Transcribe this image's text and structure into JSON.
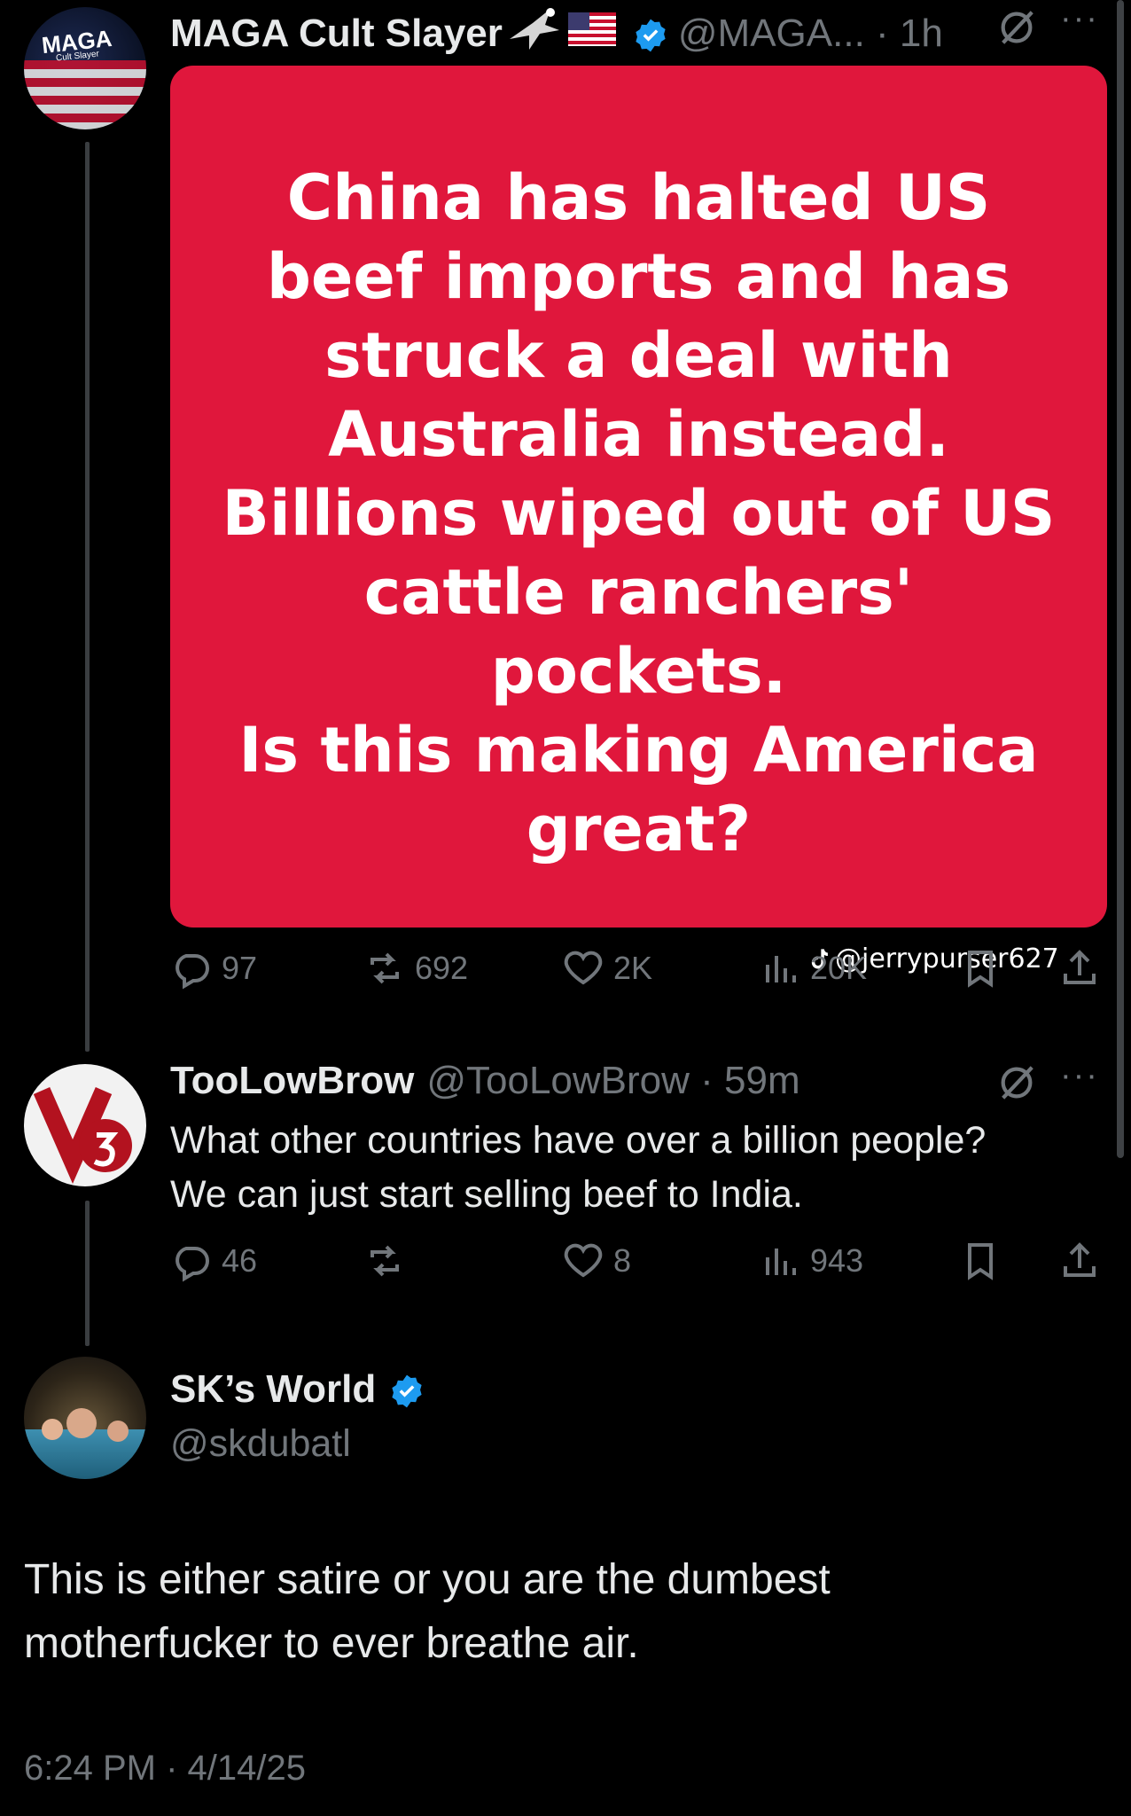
{
  "tweet1": {
    "display_name": "MAGA Cult Slayer",
    "handle_time": "@MAGA... · 1h",
    "avatar_text": "MAGA",
    "avatar_subtext": "Cult Slayer",
    "card_main": "China has halted US beef imports and has struck a deal with Australia instead. Billions wiped out of US cattle ranchers' pockets.",
    "card_question": "Is this making America great?",
    "card_watermark": "@jerrypurser627",
    "stats": {
      "replies": "97",
      "reposts": "692",
      "likes": "2K",
      "views": "20K"
    }
  },
  "tweet2": {
    "display_name": "TooLowBrow",
    "handle_time": "@TooLowBrow · 59m",
    "body_line1": "What other countries have over a billion people?",
    "body_line2": "We can just start selling beef to India.",
    "stats": {
      "replies": "46",
      "reposts": "",
      "likes": "8",
      "views": "943"
    }
  },
  "tweet3": {
    "display_name": "SK’s World",
    "handle": "@skdubatl",
    "body_line1": "This is either satire or you are the dumbest",
    "body_line2": "motherfucker to ever breathe air.",
    "timestamp": "6:24 PM · 4/14/25"
  },
  "colors": {
    "card_red": "#e0173c",
    "verified_blue": "#1d9bf0",
    "muted": "#71767b"
  }
}
